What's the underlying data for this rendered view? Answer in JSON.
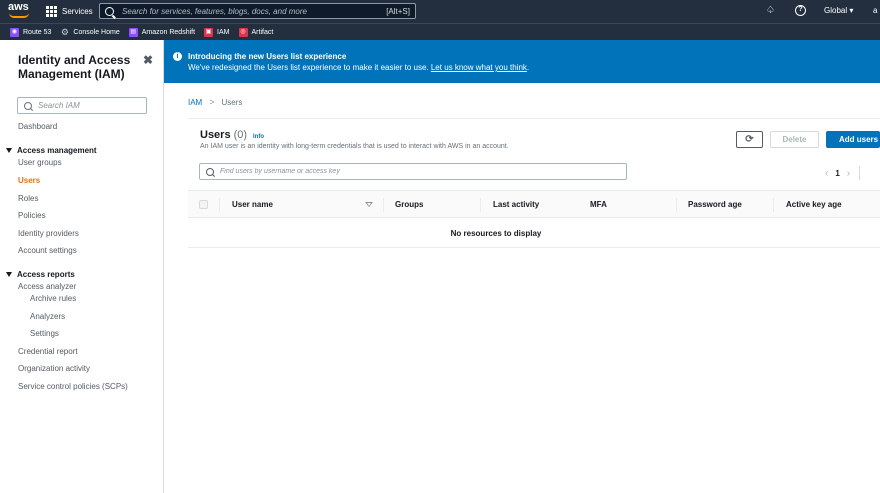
{
  "topnav": {
    "logo_text": "aws",
    "services_label": "Services",
    "search_placeholder": "Search for services, features, blogs, docs, and more",
    "search_shortcut": "[Alt+S]",
    "region_label": "Global ▾",
    "account_label": "a"
  },
  "favorites": [
    {
      "label": "Route 53",
      "icon": "route53-icon",
      "color": "#8c4fff"
    },
    {
      "label": "Console Home",
      "icon": "gear-icon",
      "color": ""
    },
    {
      "label": "Amazon Redshift",
      "icon": "redshift-icon",
      "color": "#8c4fff"
    },
    {
      "label": "IAM",
      "icon": "iam-icon",
      "color": "#dd344c"
    },
    {
      "label": "Artifact",
      "icon": "artifact-icon",
      "color": "#dd344c"
    }
  ],
  "sidebar": {
    "title": "Identity and Access Management (IAM)",
    "close_glyph": "✖",
    "search_placeholder": "Search IAM",
    "dashboard": "Dashboard",
    "access_management": {
      "heading": "Access management",
      "items": [
        "User groups",
        "Users",
        "Roles",
        "Policies",
        "Identity providers",
        "Account settings"
      ],
      "active": "Users"
    },
    "access_reports": {
      "heading": "Access reports",
      "analyzer": "Access analyzer",
      "analyzer_items": [
        "Archive rules",
        "Analyzers",
        "Settings"
      ],
      "items": [
        "Credential report",
        "Organization activity",
        "Service control policies (SCPs)"
      ]
    }
  },
  "banner": {
    "title": "Introducing the new Users list experience",
    "text": "We've redesigned the Users list experience to make it easier to use.",
    "link_text": "Let us know what you think",
    "trailing": ".",
    "color": "#0073bb"
  },
  "breadcrumb": {
    "root": "IAM",
    "current": "Users"
  },
  "users": {
    "title": "Users",
    "count": "(0)",
    "info_label": "Info",
    "description": "An IAM user is an identity with long-term credentials that is used to interact with AWS in an account.",
    "delete_label": "Delete",
    "add_label": "Add users",
    "find_placeholder": "Find users by username or access key",
    "page_number": "1",
    "columns": [
      "User name",
      "Groups",
      "Last activity",
      "MFA",
      "Password age",
      "Active key age"
    ],
    "empty_text": "No resources to display"
  }
}
